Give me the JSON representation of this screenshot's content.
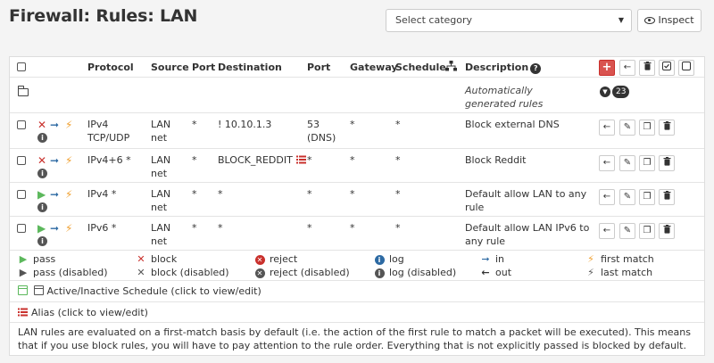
{
  "page_title": "Firewall: Rules: LAN",
  "category_select": {
    "placeholder": "Select category"
  },
  "inspect_label": "Inspect",
  "columns": {
    "protocol": "Protocol",
    "source": "Source",
    "port": "Port",
    "destination": "Destination",
    "dest_port": "Port",
    "gateway": "Gateway",
    "schedule": "Schedule",
    "description": "Description"
  },
  "auto_row": {
    "description": "Automatically generated rules",
    "count": "23"
  },
  "rules": [
    {
      "action": "block",
      "protocol": "IPv4\nTCP/UDP",
      "source": "LAN\nnet",
      "source_port": "*",
      "destination": "! 10.10.1.3",
      "dest_port": "53\n(DNS)",
      "gateway": "*",
      "schedule": "*",
      "description": "Block external DNS"
    },
    {
      "action": "block",
      "protocol": "IPv4+6 *",
      "source": "LAN\nnet",
      "source_port": "*",
      "destination": "BLOCK_REDDIT",
      "dest_port": "*",
      "gateway": "*",
      "schedule": "*",
      "description": "Block Reddit"
    },
    {
      "action": "pass",
      "protocol": "IPv4 *",
      "source": "LAN\nnet",
      "source_port": "*",
      "destination": "*",
      "dest_port": "*",
      "gateway": "*",
      "schedule": "*",
      "description": "Default allow LAN to any\nrule"
    },
    {
      "action": "pass",
      "protocol": "IPv6 *",
      "source": "LAN\nnet",
      "source_port": "*",
      "destination": "*",
      "dest_port": "*",
      "gateway": "*",
      "schedule": "*",
      "description": "Default allow LAN IPv6 to\nany rule"
    }
  ],
  "legend": {
    "pass": "pass",
    "pass_disabled": "pass (disabled)",
    "block": "block",
    "block_disabled": "block (disabled)",
    "reject": "reject",
    "reject_disabled": "reject (disabled)",
    "log": "log",
    "log_disabled": "log (disabled)",
    "in": "in",
    "out": "out",
    "first_match": "first match",
    "last_match": "last match"
  },
  "schedule_note": "Active/Inactive Schedule (click to view/edit)",
  "alias_note": "Alias (click to view/edit)",
  "footer": "LAN rules are evaluated on a first-match basis by default (i.e. the action of the first rule to match a packet will be executed). This means that if you use block rules, you will have to pay attention to the rule order. Everything that is not explicitly passed is blocked by default.",
  "colors": {
    "block": "#c9302c",
    "pass": "#5cb85c",
    "direction": "#2d6aa3",
    "match": "#f0a030",
    "add": "#d9534f"
  }
}
